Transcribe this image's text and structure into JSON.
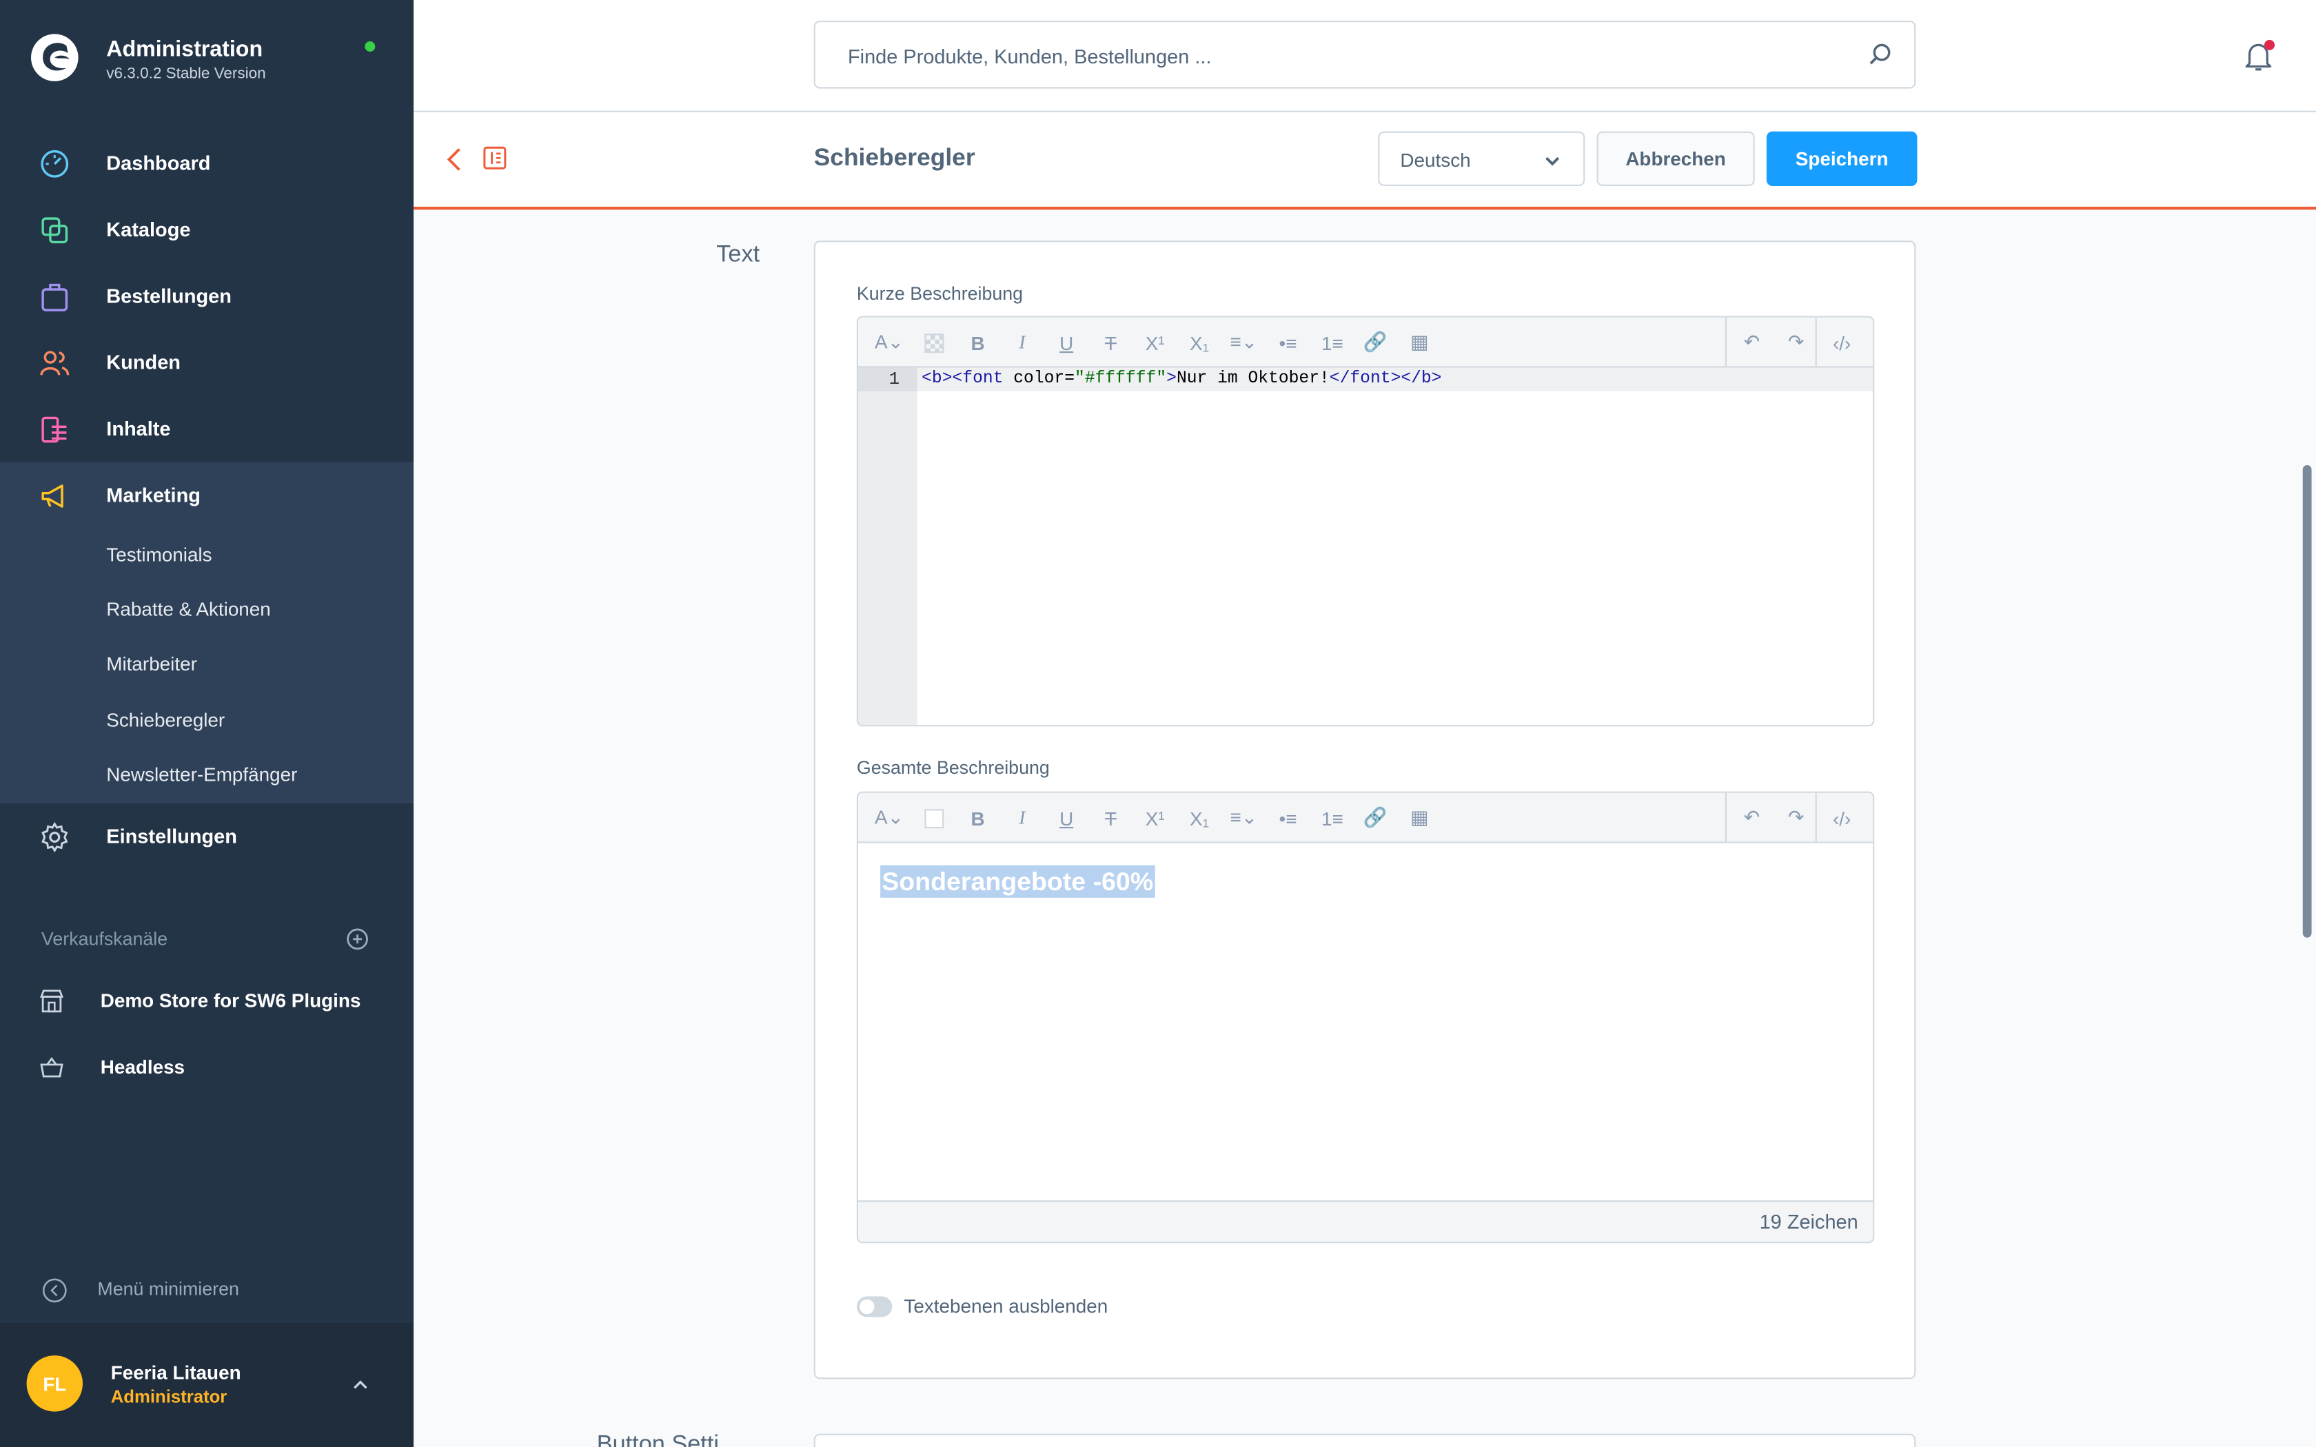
{
  "app": {
    "title": "Administration",
    "version": "v6.3.0.2 Stable Version"
  },
  "nav": {
    "dashboard": "Dashboard",
    "catalogues": "Kataloge",
    "orders": "Bestellungen",
    "customers": "Kunden",
    "content": "Inhalte",
    "marketing": "Marketing",
    "marketing_sub": [
      "Testimonials",
      "Rabatte & Aktionen",
      "Mitarbeiter",
      "Schieberegler",
      "Newsletter-Empfänger"
    ],
    "settings": "Einstellungen"
  },
  "sales_channels": {
    "title": "Verkaufskanäle",
    "items": [
      "Demo Store for SW6 Plugins",
      "Headless"
    ]
  },
  "minimize": "Menü minimieren",
  "user": {
    "initials": "FL",
    "name": "Feeria Litauen",
    "role": "Administrator"
  },
  "search": {
    "placeholder": "Finde Produkte, Kunden, Bestellungen ..."
  },
  "smartbar": {
    "title": "Schieberegler",
    "language": "Deutsch",
    "cancel": "Abbrechen",
    "save": "Speichern"
  },
  "section": {
    "label": "Text",
    "short_label": "Kurze Beschreibung",
    "code": {
      "line": "1",
      "t1": "<b><font ",
      "a1": "color",
      "eq": "=",
      "s1": "\"#ffffff\"",
      "t2": ">",
      "txt": "Nur im Oktober!",
      "t3": "</font></b>"
    },
    "full_label": "Gesamte Beschreibung",
    "full_text": "Sonderangebote -60%",
    "counter": "19 Zeichen",
    "toggle_label": "Textebenen ausblenden"
  },
  "next_section": {
    "label": "Button Setti..."
  },
  "colors": {
    "sidebar": "#243447",
    "accent": "#189eff",
    "smartbar_border": "#ee5b39",
    "brand_yellow": "#ffbd19"
  }
}
